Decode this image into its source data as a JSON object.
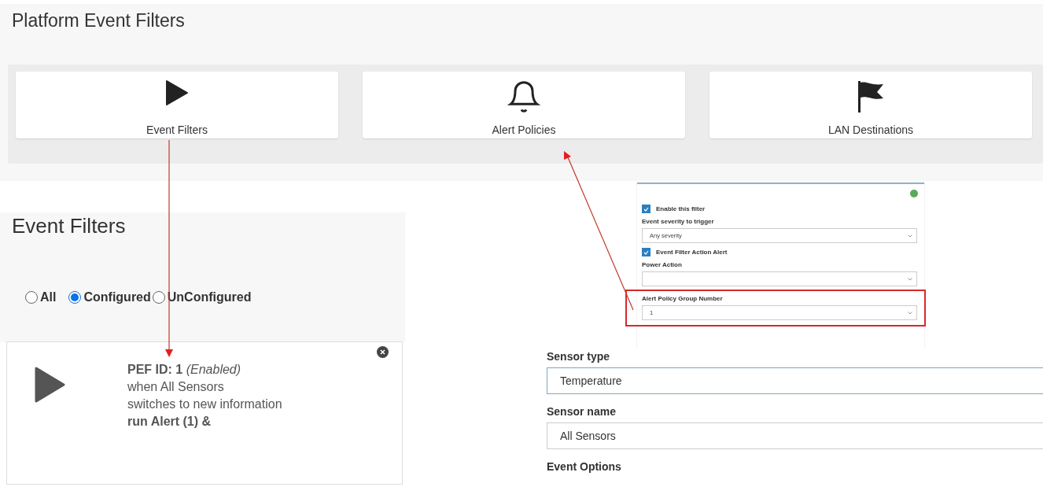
{
  "pef_page": {
    "title": "Platform Event Filters",
    "tiles": [
      {
        "label": "Event Filters",
        "kind": "play"
      },
      {
        "label": "Alert Policies",
        "kind": "bell"
      },
      {
        "label": "LAN Destinations",
        "kind": "flag"
      }
    ]
  },
  "event_filters": {
    "title": "Event Filters",
    "filter_options": [
      {
        "label": "All",
        "selected": false
      },
      {
        "label": "Configured",
        "selected": true
      },
      {
        "label": "UnConfigured",
        "selected": false
      }
    ],
    "filter_card": {
      "heading": "**PEF ID: 1** *(Enabled)*",
      "lines": [
        {
          "text": "when All Sensors",
          "kind": "plain"
        },
        {
          "text": "switches to new information",
          "kind": "plain"
        },
        {
          "text": "run Alert (1) &",
          "kind": "bold"
        }
      ]
    }
  },
  "filter_settings": {
    "rows": [
      {
        "kind": "checkbox",
        "label": "Enable this filter",
        "checked": true,
        "highlighted": false
      },
      {
        "kind": "select",
        "label": "Event severity to trigger",
        "value": "Any severity",
        "highlighted": false
      },
      {
        "kind": "checkbox",
        "label": "Event Filter Action Alert",
        "checked": true,
        "highlighted": false
      },
      {
        "kind": "select",
        "label": "Power Action",
        "highlighted": false
      },
      {
        "kind": "select",
        "label": "Alert Policy Group Number",
        "value": "1",
        "highlighted": true
      }
    ]
  },
  "sensor_settings": {
    "fields": [
      {
        "label": "Sensor type",
        "value": "Temperature",
        "focused": true
      },
      {
        "label": "Sensor name",
        "value": "All Sensors",
        "focused": false
      }
    ],
    "section_label": "Event Options"
  }
}
